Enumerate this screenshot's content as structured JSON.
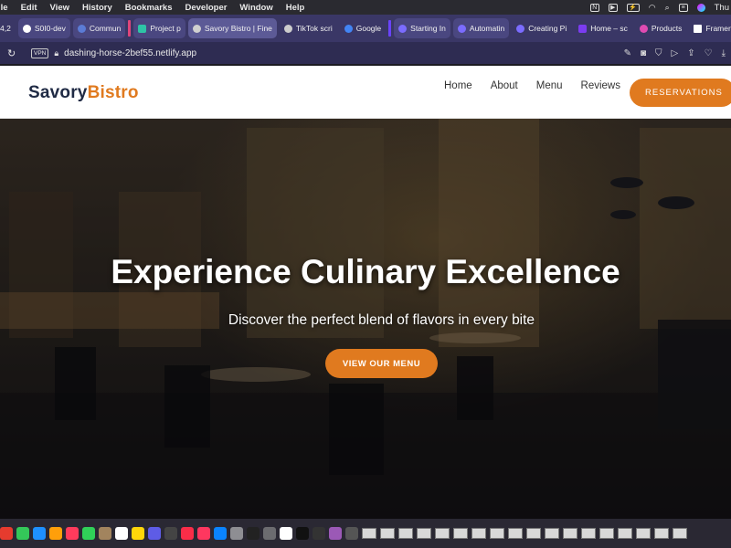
{
  "menubar": {
    "items": [
      "ile",
      "Edit",
      "View",
      "History",
      "Bookmarks",
      "Developer",
      "Window",
      "Help"
    ],
    "clock": "Thu"
  },
  "tabs": [
    {
      "label": "4,2",
      "color": "#888888"
    },
    {
      "label": "S0I0-dev",
      "color": "#ffffff"
    },
    {
      "label": "Commun",
      "color": "#5b7bd5"
    },
    {
      "label": "Project p",
      "color": "#2ec4a6"
    },
    {
      "label": "Savory Bistro | Fine",
      "color": "#d0d0d0",
      "active": true
    },
    {
      "label": "TikTok scri",
      "color": "#cccccc"
    },
    {
      "label": "Google",
      "color": "#4285f4"
    },
    {
      "label": "Starting In",
      "color": "#7b6cff"
    },
    {
      "label": "Automatin",
      "color": "#7b6cff"
    },
    {
      "label": "Creating Pi",
      "color": "#7b6cff"
    },
    {
      "label": "Home – sc",
      "color": "#7b3cf0"
    },
    {
      "label": "Products",
      "color": "#e04bb2"
    },
    {
      "label": "Framer",
      "color": "#ffffff"
    }
  ],
  "address": {
    "vpn": "VPN",
    "url": "dashing-horse-2bef55.netlify.app"
  },
  "site": {
    "logo_part1": "Savory",
    "logo_part2": "Bistro",
    "nav": [
      "Home",
      "About",
      "Menu",
      "Reviews"
    ],
    "reserve_label": "RESERVATIONS",
    "hero_title": "Experience Culinary Excellence",
    "hero_subtitle": "Discover the perfect blend of flavors in every bite",
    "hero_button": "VIEW OUR MENU"
  },
  "colors": {
    "accent": "#e07a1f",
    "logo_dark": "#1f2a44",
    "tab_strip": "#3a3766"
  },
  "dock": {
    "app_colors": [
      "#e63b2e",
      "#34c759",
      "#1e90ff",
      "#ff9f0a",
      "#ff3b5c",
      "#30d158",
      "#a2845e",
      "#ffffff",
      "#ffd60a",
      "#5e5ce6",
      "#444444",
      "#fa2d48",
      "#ff375f",
      "#0a84ff",
      "#8e8e93",
      "#222222",
      "#6c6c70",
      "#ffffff",
      "#111111",
      "#333333",
      "#9b59b6",
      "#555555"
    ],
    "thumb_count": 18
  }
}
